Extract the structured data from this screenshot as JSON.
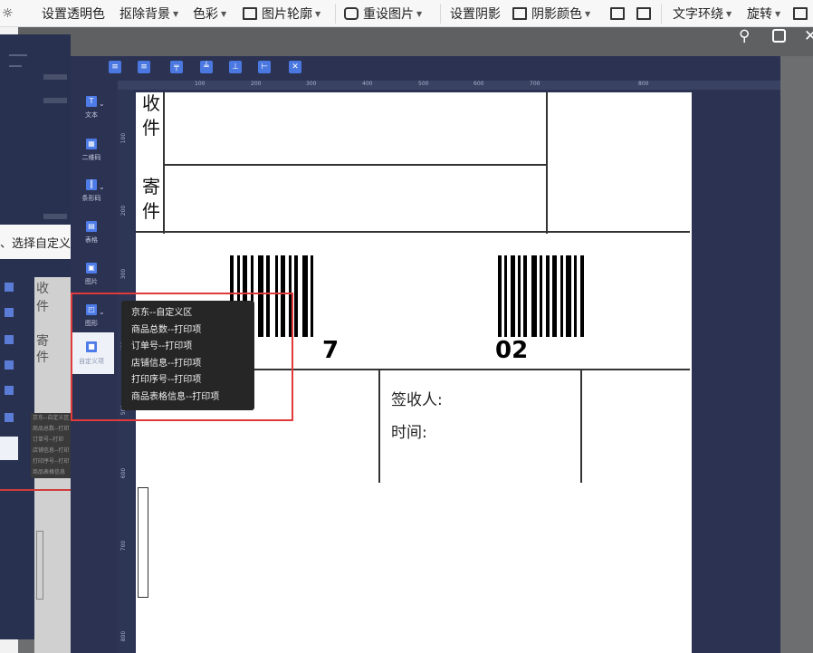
{
  "ribbon": {
    "items": [
      {
        "label": "设置透明色",
        "dropdown": false
      },
      {
        "label": "抠除背景",
        "dropdown": true
      },
      {
        "label": "色彩",
        "dropdown": true
      },
      {
        "label": "图片轮廓",
        "dropdown": true
      },
      {
        "label": "重设图片",
        "dropdown": true
      },
      {
        "label": "设置阴影",
        "dropdown": false
      },
      {
        "label": "阴影颜色",
        "dropdown": true
      },
      {
        "label": "文字环绕",
        "dropdown": true
      },
      {
        "label": "旋转",
        "dropdown": true
      }
    ]
  },
  "window_controls": {
    "pin": "pin-icon",
    "maximize": "maximize-icon",
    "close": "close-icon"
  },
  "behind_text": "、选择自定义",
  "behind_panel": {
    "chars": [
      "收",
      "件",
      "寄",
      "件"
    ],
    "popup_items": [
      "京东--自定义区",
      "商品总数--打印",
      "订单号--打印",
      "店铺信息--打印",
      "打印序号--打印",
      "商品表格信息"
    ]
  },
  "tools": [
    {
      "label": "文本",
      "icon": "text-icon",
      "dropdown": true
    },
    {
      "label": "二维码",
      "icon": "qrcode-icon",
      "dropdown": false
    },
    {
      "label": "条形码",
      "icon": "barcode-icon",
      "dropdown": true
    },
    {
      "label": "表格",
      "icon": "table-icon",
      "dropdown": false
    },
    {
      "label": "图片",
      "icon": "image-icon",
      "dropdown": false
    },
    {
      "label": "图形",
      "icon": "shape-icon",
      "dropdown": true
    },
    {
      "label": "自定义项",
      "icon": "custom-icon",
      "dropdown": false
    }
  ],
  "ruler_top": [
    "100",
    "200",
    "300",
    "400",
    "500",
    "600",
    "700",
    "800"
  ],
  "ruler_left": [
    "100",
    "200",
    "300",
    "400",
    "500",
    "600",
    "700",
    "800"
  ],
  "label": {
    "receiver_chars": [
      "收",
      "件"
    ],
    "sender_chars": [
      "寄",
      "件"
    ],
    "barcode_left_text": "7",
    "barcode_right_text": "02",
    "signer": "签收人:",
    "time": "时间:"
  },
  "custom_menu": {
    "items": [
      "京东--自定义区",
      "商品总数--打印项",
      "订单号--打印项",
      "店铺信息--打印项",
      "打印序号--打印项",
      "商品表格信息--打印项"
    ]
  },
  "colors": {
    "accent": "#4d7be8",
    "highlight": "#e03a3a",
    "panel": "#2b3252"
  }
}
